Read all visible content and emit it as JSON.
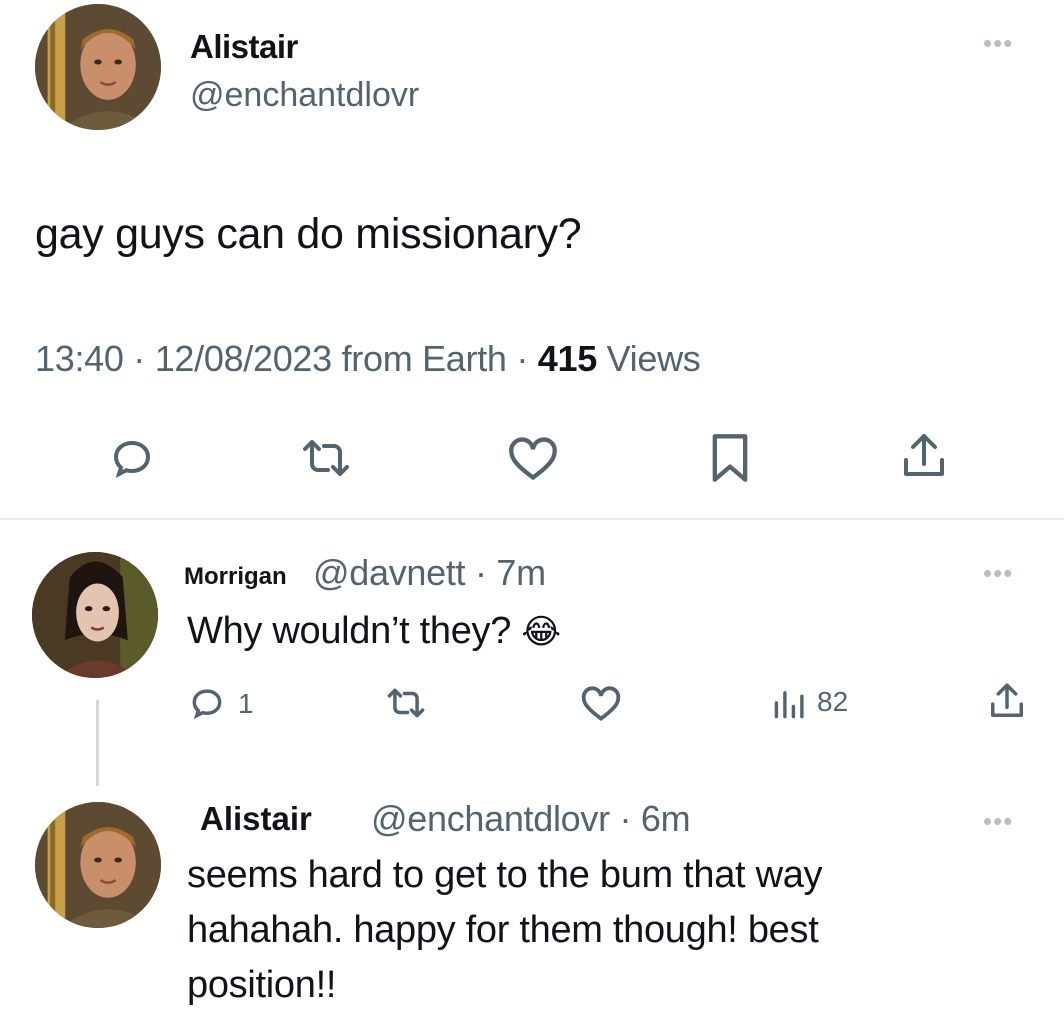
{
  "main_tweet": {
    "author_name": "Alistair",
    "author_handle": "@enchantdlovr",
    "more_icon": "more-dots-icon",
    "text": "gay guys can do missionary?",
    "time": "13:40",
    "separator": "·",
    "date": "12/08/2023 from Earth",
    "views_count": "415",
    "views_label": "Views",
    "actions": [
      "reply-icon",
      "retweet-icon",
      "like-icon",
      "bookmark-icon",
      "share-icon"
    ]
  },
  "replies": [
    {
      "author_name": "Morrigan",
      "author_handle": "@davnett",
      "time": "7m",
      "text": "Why wouldn’t they?",
      "emoji": "😂",
      "reply_count": "1",
      "views_count": "82",
      "actions": [
        "reply-icon",
        "retweet-icon",
        "like-icon",
        "views-icon",
        "share-icon"
      ]
    },
    {
      "author_name": "Alistair",
      "author_handle": "@enchantdlovr",
      "time": "6m",
      "text_lines": [
        "seems hard to get to the bum that way",
        "hahahah. happy for them though! best",
        "position!!"
      ]
    }
  ],
  "colors": {
    "text": "#0f1419",
    "secondary": "#536471",
    "divider": "#e6e8ea",
    "background": "#ffffff"
  }
}
